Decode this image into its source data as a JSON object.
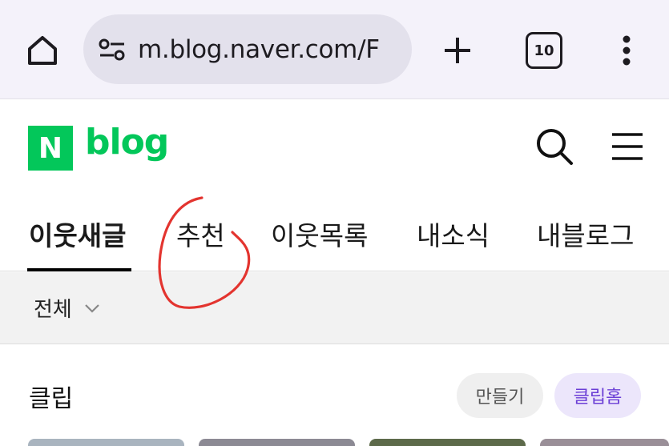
{
  "browser": {
    "url": "m.blog.naver.com/F",
    "tab_count": "10",
    "icons": {
      "home": "home-icon",
      "site_settings": "tune-icon",
      "new_tab": "plus-icon",
      "tabs": "tab-switcher-icon",
      "menu": "more-vertical-icon"
    }
  },
  "header": {
    "logo_letter": "N",
    "logo_word": "blog",
    "brand_color": "#03c75a",
    "icons": {
      "search": "search-icon",
      "menu": "hamburger-icon"
    }
  },
  "tabs": [
    {
      "label": "이웃새글",
      "active": true
    },
    {
      "label": "추천",
      "active": false
    },
    {
      "label": "이웃목록",
      "active": false
    },
    {
      "label": "내소식",
      "active": false
    },
    {
      "label": "내블로그",
      "active": false
    }
  ],
  "filter": {
    "label": "전체"
  },
  "clip": {
    "title": "클립",
    "make_label": "만들기",
    "home_label": "클립홈",
    "accent_color": "#6b3fd6"
  },
  "annotation": {
    "color": "#e3342f",
    "shape": "hand-drawn circle around 추천 tab"
  }
}
